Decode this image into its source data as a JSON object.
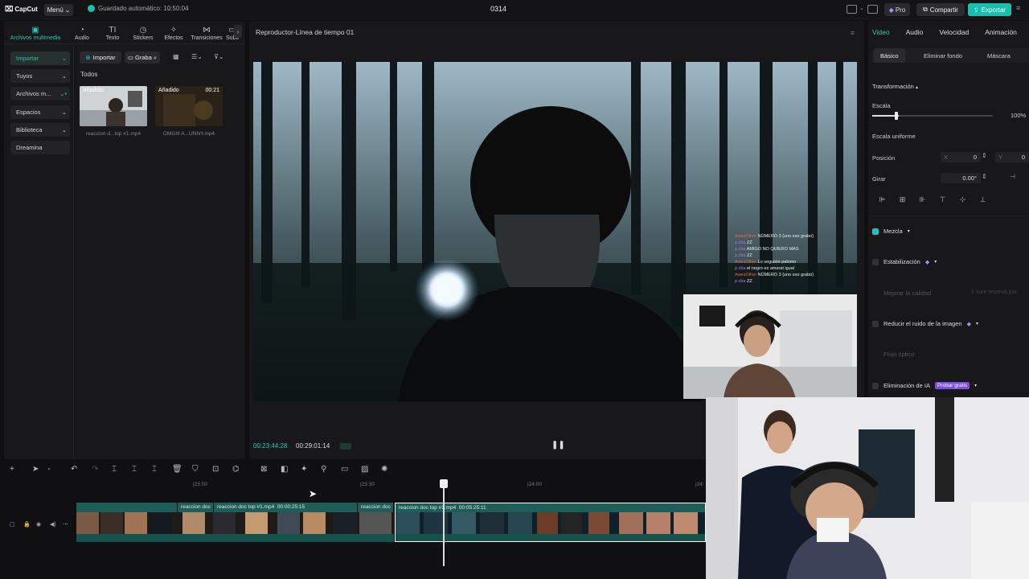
{
  "titlebar": {
    "logo": "CapCut",
    "menu": "Menú",
    "autosave": "Guardado automático: 10:50:04",
    "project": "0314",
    "pro": "Pro",
    "share": "Compartir",
    "export": "Exportar"
  },
  "media_tabs": [
    {
      "label": "Archivos multimedia",
      "icon": "play-square-icon"
    },
    {
      "label": "Audio",
      "icon": "audio-icon"
    },
    {
      "label": "Texto",
      "icon": "text-icon"
    },
    {
      "label": "Stickers",
      "icon": "sticker-icon"
    },
    {
      "label": "Efectos",
      "icon": "effects-icon"
    },
    {
      "label": "Transiciones",
      "icon": "transition-icon"
    },
    {
      "label": "Subti",
      "icon": "subtitle-icon"
    }
  ],
  "sidenav": [
    "Importar",
    "Tuyos",
    "Archivos m...",
    "Espacios",
    "Biblioteca",
    "Dreamina"
  ],
  "media": {
    "import": "Importar",
    "record": "Graba",
    "all": "Todos",
    "items": [
      {
        "badge": "Añadido",
        "duration": "",
        "name": "reaccion d...top #1.mp4"
      },
      {
        "badge": "Añadido",
        "duration": "00:21",
        "name": "OMGIII A...UNNY.mp4"
      }
    ]
  },
  "player": {
    "title": "Reproductor-Línea de tiempo 01",
    "current": "00:23:44:28",
    "total": "00:29:01:14"
  },
  "chat": [
    {
      "user": "AwesOther",
      "msg": "NÚMERO 3 (uno eso grabo)"
    },
    {
      "user": "p.cba",
      "msg": "ZZ"
    },
    {
      "user": "p.cba",
      "msg": "AMIGO NO QUIERO MAS"
    },
    {
      "user": "p.cba",
      "msg": "ZZ"
    },
    {
      "user": "AwesOther",
      "msg": "Lo seguiste palomo"
    },
    {
      "user": "p.cba",
      "msg": "el negro es amarat igual"
    },
    {
      "user": "AwesOther",
      "msg": "NÚMERO 3 (uno eso grabo)"
    },
    {
      "user": "p.cba",
      "msg": "ZZ"
    }
  ],
  "right": {
    "tabs": [
      "Video",
      "Audio",
      "Velocidad",
      "Animación"
    ],
    "subtabs": [
      "Básico",
      "Eliminar fondo",
      "Máscara"
    ],
    "transform": "Transformación",
    "scale": "Escala",
    "scale_value": "100%",
    "scale_fraction": 0.07,
    "uniform": "Escala uniforme",
    "position": "Posición",
    "pos_x_label": "X",
    "pos_x": "0",
    "pos_y_label": "Y",
    "pos_y": "0",
    "rotate": "Girar",
    "rotate_value": "0.00°",
    "blend": "Mezcla",
    "stabilize": "Estabilización",
    "improve": "Mejorar la calidad",
    "improve_extra": "1 sure reserva por",
    "denoise": "Reducir el ruido de la imagen",
    "optical": "Flujo óptico",
    "ai_remove": "Eliminación de IA",
    "try_free": "Probar gratis"
  },
  "ruler": [
    "|23:00",
    "|23:30",
    "|24:00",
    "|24:"
  ],
  "clips": [
    {
      "label": "",
      "start": "",
      "duration": ""
    },
    {
      "label": "reaccion doc",
      "start": "",
      "duration": ""
    },
    {
      "label": "reaccion doc top #1.mp4",
      "start": "",
      "duration": "00:00:25:15"
    },
    {
      "label": "reaccion doc",
      "start": "",
      "duration": ""
    },
    {
      "label": "reaccion doc top #1.mp4",
      "start": "",
      "duration": "00:05:25:11"
    }
  ],
  "colors": {
    "accent": "#1fbfae",
    "bg": "#101012",
    "panel": "#18181b"
  }
}
